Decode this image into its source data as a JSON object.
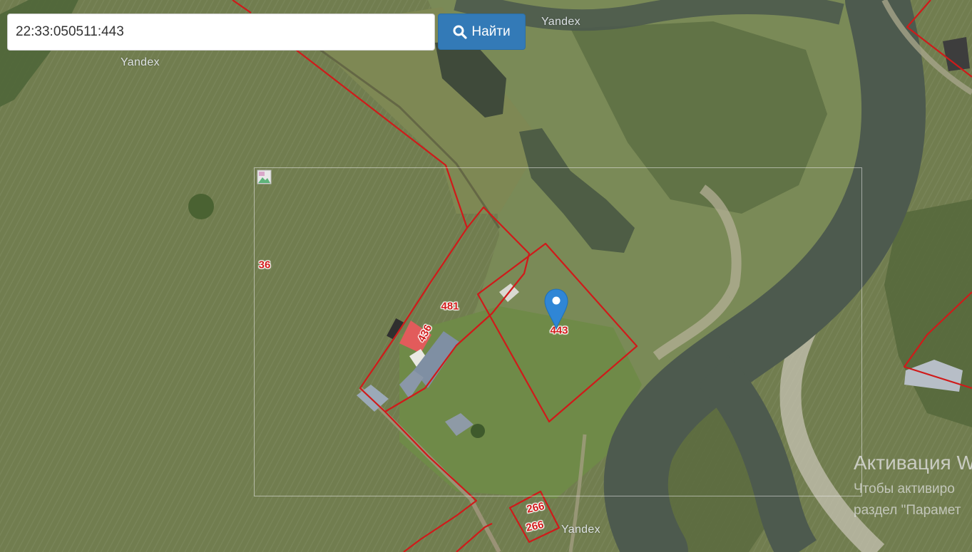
{
  "search": {
    "value": "22:33:050511:443",
    "button_label": "Найти"
  },
  "map": {
    "provider_watermarks": [
      "Yandex",
      "Yandex",
      "Yandex"
    ],
    "parcel_labels": [
      "36",
      "481",
      "436",
      "443",
      "266",
      "266"
    ],
    "selected_parcel": "443",
    "parcel_border_color": "#d01a1a",
    "marker_color": "#2f86d6"
  },
  "overlay": {
    "activation_title": "Активация W",
    "activation_line_1": "Чтобы активиро",
    "activation_line_2": "раздел \"Парамет"
  },
  "icons": {
    "search_button_icon": "search-icon",
    "marker_icon": "map-marker-icon",
    "broken_image_icon": "broken-image-icon"
  }
}
